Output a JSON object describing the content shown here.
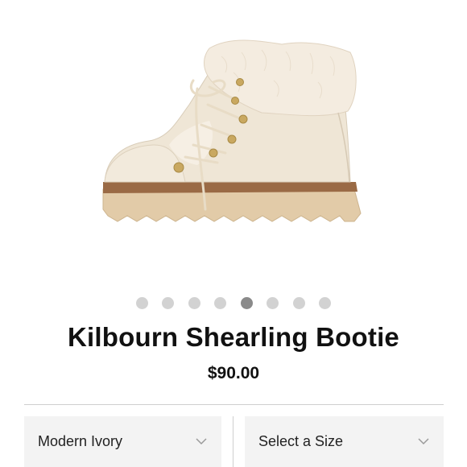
{
  "product": {
    "image": "ivory-lace-up-shearling-bootie",
    "title": "Kilbourn Shearling Bootie",
    "price": "$90.00"
  },
  "carousel": {
    "count": 8,
    "active_index": 4
  },
  "options": {
    "color_selected": "Modern Ivory",
    "size_placeholder": "Select a Size"
  },
  "icons": {
    "dropdown": "chevron-down-icon"
  },
  "colors": {
    "text": "#111111",
    "dot": "#d2d2d2",
    "dot_active": "#8a8a8a",
    "select_bg": "#f3f3f3",
    "divider": "#cfcfcf"
  }
}
